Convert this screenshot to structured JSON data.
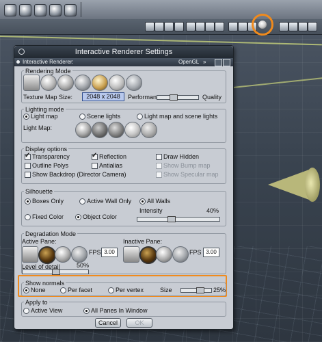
{
  "dialog": {
    "title": "Interactive Renderer Settings",
    "renderer_label": "Interactive Renderer:",
    "renderer_value": "OpenGL",
    "rendering_mode": {
      "title": "Rendering Mode",
      "texture_map_size_label": "Texture Map Size:",
      "texture_map_size_value": "2048 x 2048",
      "performance_label": "Performance",
      "quality_label": "Quality",
      "performance_quality_level": 0.35
    },
    "lighting_mode": {
      "title": "Lighting mode",
      "options": [
        "Light map",
        "Scene lights",
        "Light map and scene lights"
      ],
      "selected": "Light map",
      "light_map_label": "Light Map:"
    },
    "display_options": {
      "title": "Display options",
      "transparency": "Transparency",
      "reflection": "Reflection",
      "draw_hidden": "Draw Hidden",
      "outline_polys": "Outline Polys",
      "antialias": "Antialias",
      "show_bump_map": "Show Bump map",
      "show_backdrop": "Show Backdrop (Director Camera)",
      "show_specular_map": "Show Specular map"
    },
    "silhouette": {
      "title": "Silhouette",
      "boxes_only": "Boxes Only",
      "active_wall_only": "Active Wall Only",
      "all_walls": "All Walls",
      "fixed_color": "Fixed Color",
      "object_color": "Object Color",
      "intensity_label": "Intensity",
      "intensity_value": "40%"
    },
    "degradation_mode": {
      "title": "Degradation Mode",
      "active_pane_label": "Active Pane:",
      "inactive_pane_label": "Inactive Pane:",
      "fps_label": "FPS",
      "active_fps": "3.00",
      "inactive_fps": "3.00",
      "level_of_detail_label": "Level of detail",
      "level_of_detail_value": "50%"
    },
    "show_normals": {
      "title": "Show normals",
      "none": "None",
      "per_facet": "Per facet",
      "per_vertex": "Per vertex",
      "size_label": "Size",
      "size_value": "25%"
    },
    "apply_to": {
      "title": "Apply to",
      "active_view": "Active View",
      "all_panes": "All Panes In Window"
    },
    "cancel_label": "Cancel",
    "ok_label": "OK"
  },
  "colors": {
    "highlight": "#f08a1c",
    "dialog_bg": "#c8ccd3",
    "titlebar": "#2b333c"
  }
}
